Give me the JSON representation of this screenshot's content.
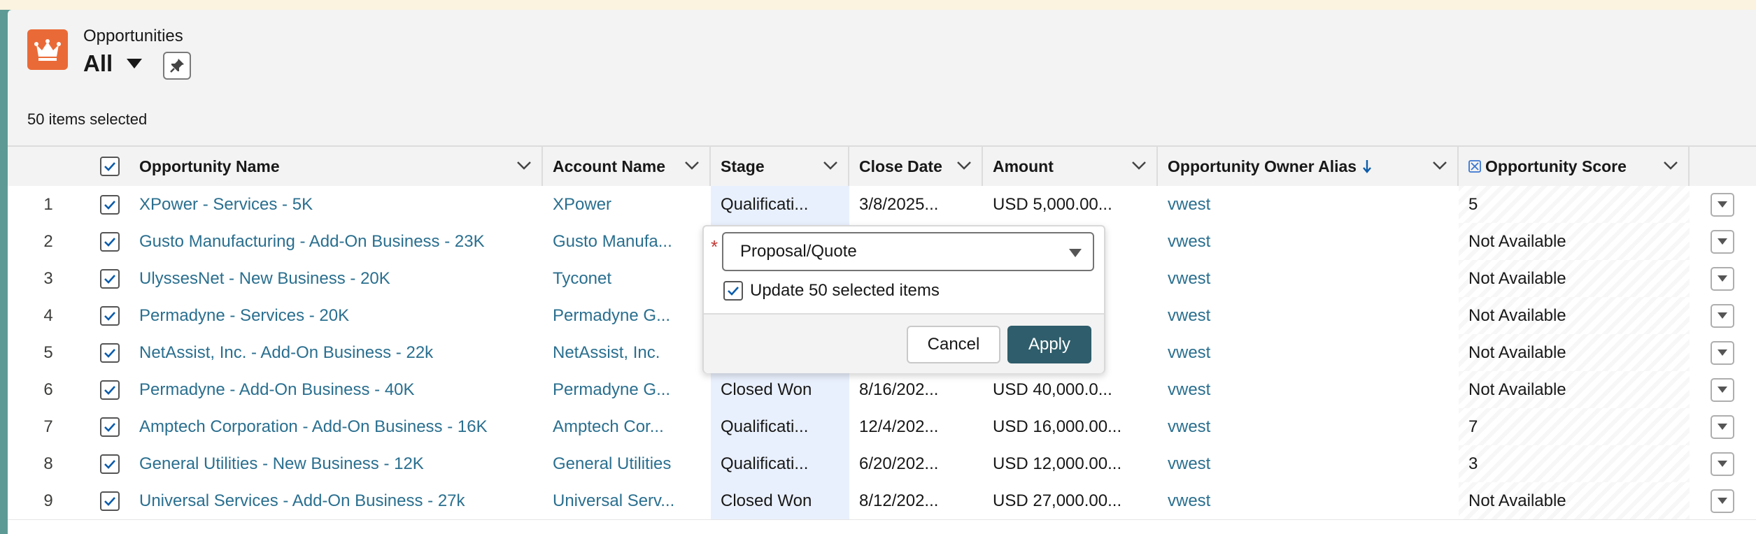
{
  "header": {
    "object_label": "Opportunities",
    "view_name": "All",
    "app_icon": "crown-icon",
    "pin_icon": "pin-icon",
    "selected_count": "50 items selected"
  },
  "columns": {
    "opportunity_name": "Opportunity Name",
    "account_name": "Account Name",
    "stage": "Stage",
    "close_date": "Close Date",
    "amount": "Amount",
    "owner_alias": "Opportunity Owner Alias",
    "score": "Opportunity Score",
    "sort_icon": "arrow-down-icon",
    "score_icon": "einstein-icon"
  },
  "rows": [
    {
      "num": "1",
      "name": "XPower - Services - 5K",
      "account": "XPower",
      "stage": "Qualificati...",
      "close": "3/8/2025...",
      "amount": "USD 5,000.00...",
      "owner": "vwest",
      "score": "5"
    },
    {
      "num": "2",
      "name": "Gusto Manufacturing - Add-On Business - 23K",
      "account": "Gusto Manufa...",
      "stage": "",
      "close": "",
      "amount": "",
      "owner": "vwest",
      "score": "Not Available"
    },
    {
      "num": "3",
      "name": "UlyssesNet - New Business - 20K",
      "account": "Tyconet",
      "stage": "",
      "close": "",
      "amount": "",
      "owner": "vwest",
      "score": "Not Available"
    },
    {
      "num": "4",
      "name": "Permadyne - Services - 20K",
      "account": "Permadyne G...",
      "stage": "",
      "close": "",
      "amount": "",
      "owner": "vwest",
      "score": "Not Available"
    },
    {
      "num": "5",
      "name": "NetAssist, Inc. - Add-On Business - 22k",
      "account": "NetAssist, Inc.",
      "stage": "",
      "close": "",
      "amount": "",
      "owner": "vwest",
      "score": "Not Available"
    },
    {
      "num": "6",
      "name": "Permadyne - Add-On Business - 40K",
      "account": "Permadyne G...",
      "stage": "Closed Won",
      "close": "8/16/202...",
      "amount": "USD 40,000.0...",
      "owner": "vwest",
      "score": "Not Available"
    },
    {
      "num": "7",
      "name": "Amptech Corporation - Add-On Business - 16K",
      "account": "Amptech Cor...",
      "stage": "Qualificati...",
      "close": "12/4/202...",
      "amount": "USD 16,000.00...",
      "owner": "vwest",
      "score": "7"
    },
    {
      "num": "8",
      "name": "General Utilities - New Business - 12K",
      "account": "General Utilities",
      "stage": "Qualificati...",
      "close": "6/20/202...",
      "amount": "USD 12,000.00...",
      "owner": "vwest",
      "score": "3"
    },
    {
      "num": "9",
      "name": "Universal Services - Add-On Business - 27k",
      "account": "Universal Serv...",
      "stage": "Closed Won",
      "close": "8/12/202...",
      "amount": "USD 27,000.00...",
      "owner": "vwest",
      "score": "Not Available"
    }
  ],
  "popover": {
    "required_mark": "*",
    "stage_value": "Proposal/Quote",
    "update_label": "Update 50 selected items",
    "update_checked": true,
    "cancel_label": "Cancel",
    "apply_label": "Apply"
  },
  "colors": {
    "brand_icon": "#ea6a37",
    "link": "#2a6f8f",
    "apply_button": "#2f5d6b",
    "stage_highlight": "#e9f0fd"
  }
}
